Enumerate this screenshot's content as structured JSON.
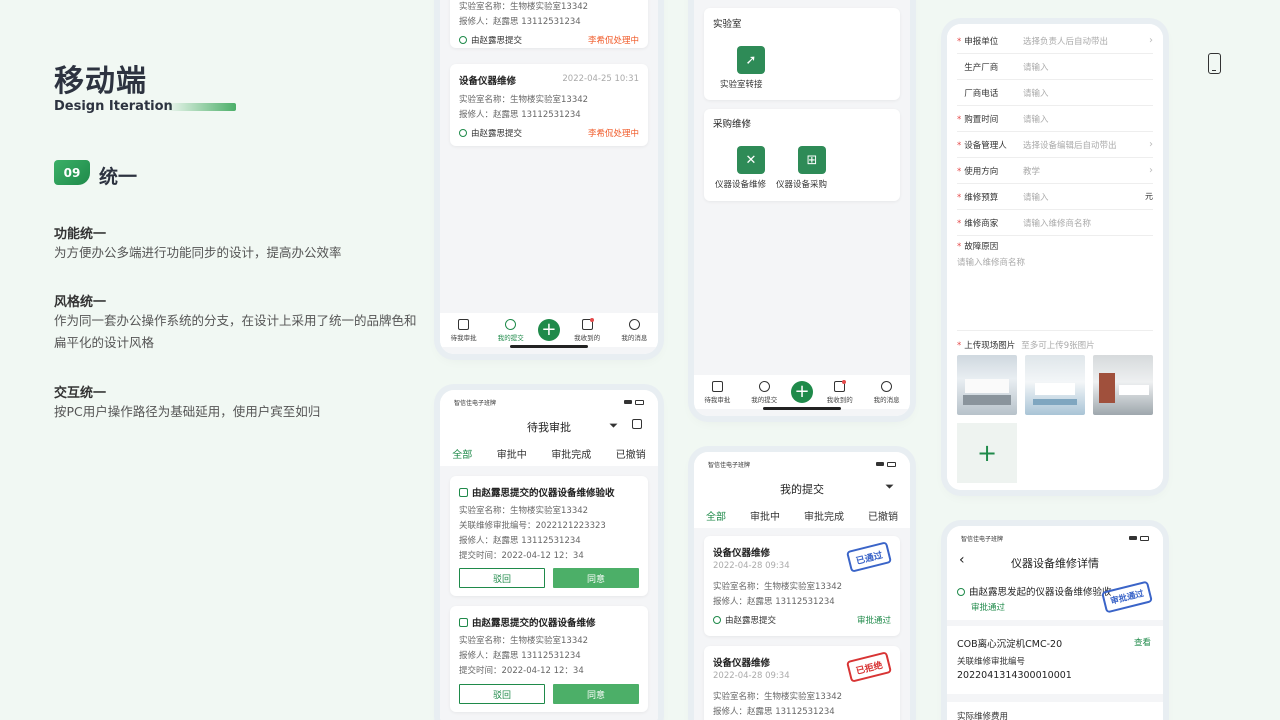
{
  "intro": {
    "title": "移动端",
    "subtitle": "Design Iteration",
    "section_number": "09",
    "section_title": "统一",
    "features": [
      {
        "heading": "功能统一",
        "text": "为方便办公多端进行功能同步的设计，提高办公效率"
      },
      {
        "heading": "风格统一",
        "text": "作为同一套办公操作系统的分支，在设计上采用了统一的品牌色和扁平化的设计风格"
      },
      {
        "heading": "交互统一",
        "text": "按PC用户操作路径为基础延用，使用户宾至如归"
      }
    ]
  },
  "phone1": {
    "card_a": {
      "lab": "实验室名称：生物楼实验室13342",
      "reporter": "报修人：赵露思 13112531234",
      "submitter": "由赵露思提交",
      "status": "李希侃处理中"
    },
    "card_b": {
      "title": "设备仪器维修",
      "time": "2022-04-25 10:31",
      "lab": "实验室名称：生物楼实验室13342",
      "reporter": "报修人：赵露思 13112531234",
      "submitter": "由赵露思提交",
      "status": "李希侃处理中"
    },
    "tabs": [
      "待我审批",
      "我的提交",
      "我收到的",
      "我的消息"
    ]
  },
  "phone2": {
    "app_name": "智信佳电子班牌",
    "title": "待我审批",
    "segments": [
      "全部",
      "审批中",
      "审批完成",
      "已撤销"
    ],
    "card_a": {
      "title": "由赵露思提交的仪器设备维修验收",
      "lab": "实验室名称：生物楼实验室13342",
      "ref": "关联维修审批编号：2022121223323",
      "reporter": "报修人：赵露思 13112531234",
      "time": "提交时间：2022-04-12 12：34",
      "reject": "驳回",
      "agree": "同意"
    },
    "card_b": {
      "title": "由赵露思提交的仪器设备维修",
      "lab": "实验室名称：生物楼实验室13342",
      "reporter": "报修人：赵露思 13112531234",
      "time": "提交时间：2022-04-12 12：34",
      "reject": "驳回",
      "agree": "同意"
    }
  },
  "phone3": {
    "section_lab": "实验室",
    "lab_transfer": "实验室转接",
    "section_purchase": "采购维修",
    "repair": "仪器设备维修",
    "purchase": "仪器设备采购",
    "tabs": [
      "待我审批",
      "我的提交",
      "我收到的",
      "我的消息"
    ]
  },
  "phone4": {
    "app_name": "智信佳电子班牌",
    "title": "我的提交",
    "segments": [
      "全部",
      "审批中",
      "审批完成",
      "已撤销"
    ],
    "card_a": {
      "title": "设备仪器维修",
      "time": "2022-04-28 09:34",
      "lab": "实验室名称：生物楼实验室13342",
      "reporter": "报修人：赵露思 13112531234",
      "submitter": "由赵露思提交",
      "status": "审批通过",
      "stamp": "已通过"
    },
    "card_b": {
      "title": "设备仪器维修",
      "time": "2022-04-28 09:34",
      "lab": "实验室名称：生物楼实验室13342",
      "reporter": "报修人：赵露思 13112531234",
      "stamp": "已拒绝"
    }
  },
  "phone5": {
    "rows": [
      {
        "label": "申报单位",
        "value": "选择负责人后自动带出",
        "req": true,
        "arrow": "›"
      },
      {
        "label": "生产厂商",
        "value": "请输入",
        "req": false,
        "arrow": ""
      },
      {
        "label": "厂商电话",
        "value": "请输入",
        "req": false,
        "arrow": ""
      },
      {
        "label": "购置时间",
        "value": "请输入",
        "req": true,
        "arrow": ""
      },
      {
        "label": "设备管理人",
        "value": "选择设备编辑后自动带出",
        "req": true,
        "arrow": "›"
      },
      {
        "label": "使用方向",
        "value": "教学",
        "req": true,
        "arrow": "›"
      },
      {
        "label": "维修预算",
        "value": "请输入",
        "req": true,
        "arrow": "元"
      },
      {
        "label": "维修商家",
        "value": "请输入维修商名称",
        "req": true,
        "arrow": ""
      }
    ],
    "fault_label": "故障原因",
    "fault_placeholder": "请输入维修商名称",
    "upload_label": "上传现场图片",
    "upload_hint": "至多可上传9张图片"
  },
  "phone6": {
    "app_name": "智信佳电子班牌",
    "title": "仪器设备维修详情",
    "initiator": "由赵露思发起的仪器设备维修验收",
    "status": "审批通过",
    "stamp": "审批通过",
    "device": "COB离心沉淀机CMC-20",
    "view": "查看",
    "ref_label": "关联维修审批编号",
    "ref_value": "2022041314300010001",
    "cost_label": "实际维修费用"
  },
  "colors": {
    "brand": "#1f8a4a",
    "accent": "#4caf68",
    "warning": "#f05a28",
    "stamp_blue": "#3a64c8",
    "stamp_red": "#d83434"
  }
}
